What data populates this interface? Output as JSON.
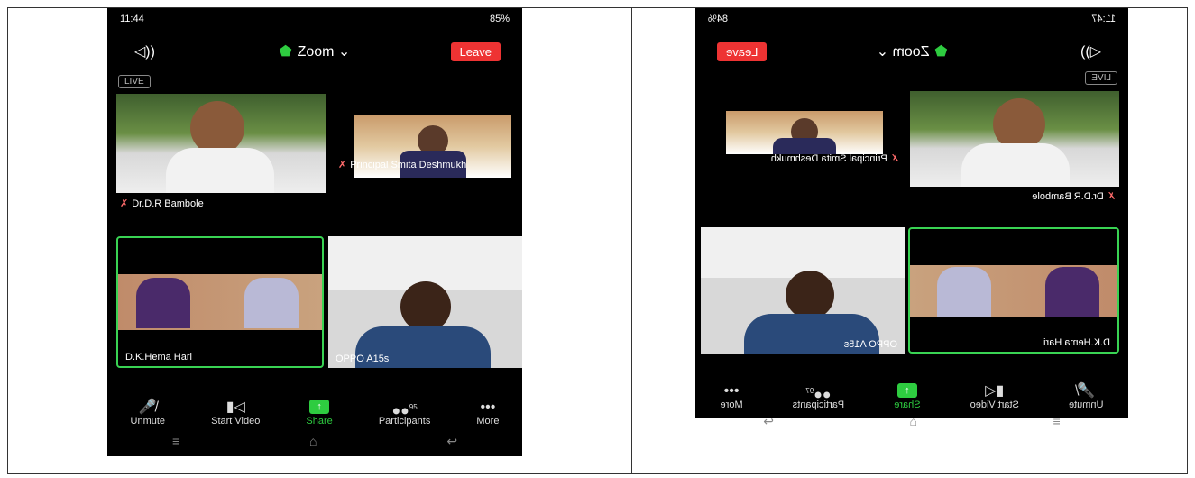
{
  "left": {
    "status_time": "11:44",
    "status_battery": "85%",
    "title": "Zoom",
    "leave": "Leave",
    "live": "LIVE",
    "tiles": {
      "bambole": "Dr.D.R Bambole",
      "principal": "Principal Smita Deshmukh",
      "hema": "D.K.Hema Hari",
      "oppo": "OPPO A15s"
    },
    "toolbar": {
      "unmute": "Unmute",
      "start_video": "Start Video",
      "share": "Share",
      "participants": "Participants",
      "participants_count": "95",
      "more": "More"
    }
  },
  "right": {
    "status_time": "11:47",
    "status_battery": "84%",
    "title": "Zoom",
    "leave": "Leave",
    "live": "LIVE",
    "tiles": {
      "bambole": "Dr.D.R Bambole",
      "principal": "Principal Smita Deshmukh",
      "hema": "D.K.Hema Hari",
      "oppo": "OPPO A15s"
    },
    "toolbar": {
      "unmute": "Unmute",
      "start_video": "Start Video",
      "share": "Share",
      "participants": "Participants",
      "participants_count": "97",
      "more": "More"
    }
  },
  "colors": {
    "leave": "#e33333",
    "active_speaker": "#39d353",
    "share": "#2ecc40"
  },
  "icons": [
    "speaker-icon",
    "shield-icon",
    "chevron-down-icon",
    "mic-muted-icon",
    "video-off-icon",
    "share-arrow-icon",
    "participants-icon",
    "more-dots-icon",
    "menu-icon",
    "home-icon",
    "back-icon"
  ]
}
